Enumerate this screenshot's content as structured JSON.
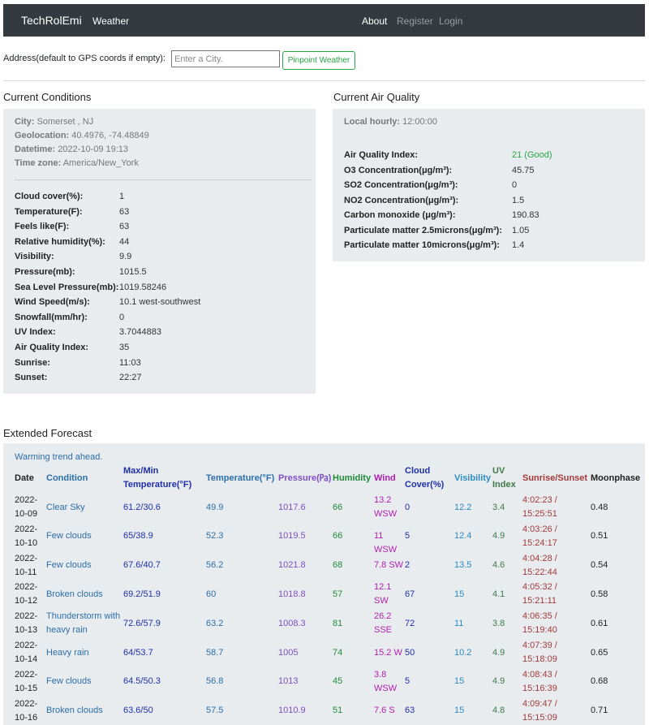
{
  "nav": {
    "brand": "TechRolEmi",
    "weather": "Weather",
    "about": "About",
    "register": "Register",
    "login": "Login"
  },
  "address": {
    "label": "Address(default to GPS coords if empty):",
    "placeholder": "Enter a City.",
    "value": "",
    "button": "Pinpoint Weather"
  },
  "current": {
    "title": "Current Conditions",
    "city_label": "City:",
    "city": "Somerset , NJ",
    "geo_label": "Geolocation:",
    "geo": "40.4976, -74.48849",
    "datetime_label": "Datetime:",
    "datetime": "2022-10-09 19:13",
    "tz_label": "Time zone:",
    "tz": "America/New_York",
    "rows": [
      {
        "label": "Cloud cover(%):",
        "value": "1"
      },
      {
        "label": "Temperature(F):",
        "value": "63"
      },
      {
        "label": "Feels like(F):",
        "value": "63"
      },
      {
        "label": "Relative humidity(%):",
        "value": "44"
      },
      {
        "label": "Visibility:",
        "value": "9.9"
      },
      {
        "label": "Pressure(mb):",
        "value": "1015.5"
      },
      {
        "label": "Sea Level Pressure(mb):",
        "value": "1019.58246"
      },
      {
        "label": "Wind Speed(m/s):",
        "value": "10.1 west-southwest"
      },
      {
        "label": "Snowfall(mm/hr):",
        "value": "0"
      },
      {
        "label": "UV Index:",
        "value": "3.7044883"
      },
      {
        "label": "Air Quality Index:",
        "value": "35"
      },
      {
        "label": "Sunrise:",
        "value": "11:03"
      },
      {
        "label": "Sunset:",
        "value": "22:27"
      }
    ]
  },
  "air": {
    "title": "Current Air Quality",
    "local_label": "Local hourly:",
    "local": "12:00:00",
    "rows": [
      {
        "label": "Air Quality Index:",
        "value": "21 (Good)"
      },
      {
        "label": "O3 Concentration(μg/m³):",
        "value": "45.75"
      },
      {
        "label": "SO2 Concentration(μg/m³):",
        "value": "0"
      },
      {
        "label": "NO2 Concentration(μg/m³):",
        "value": "1.5"
      },
      {
        "label": "Carbon monoxide (μg/m³):",
        "value": "190.83"
      },
      {
        "label": "Particulate matter 2.5microns(μg/m³):",
        "value": "1.05"
      },
      {
        "label": "Particulate matter 10microns(μg/m³):",
        "value": "1.4"
      }
    ]
  },
  "forecast": {
    "title": "Extended Forecast",
    "trend": "Warming trend ahead.",
    "headers": {
      "date": "Date",
      "condition": "Condition",
      "maxmin": "Max/Min Temperature(°F)",
      "temp": "Temperature(°F)",
      "pressure": "Pressure(㎩)",
      "humidity": "Humidity",
      "wind": "Wind",
      "cloud": "Cloud Cover(%)",
      "visibility": "Visibility",
      "uv": "UV Index",
      "sun": "Sunrise/Sunset",
      "moon": "Moonphase"
    },
    "rows": [
      {
        "date": "2022-10-09",
        "condition": "Clear Sky",
        "maxmin": "61.2/30.6",
        "temp": "49.9",
        "pressure": "1017.6",
        "humidity": "66",
        "wind": "13.2 WSW",
        "cloud": "0",
        "visibility": "12.2",
        "uv": "3.4",
        "sun": "4:02:23 / 15:25:51",
        "moon": "0.48"
      },
      {
        "date": "2022-10-10",
        "condition": "Few clouds",
        "maxmin": "65/38.9",
        "temp": "52.3",
        "pressure": "1019.5",
        "humidity": "66",
        "wind": "11 WSW",
        "cloud": "5",
        "visibility": "12.4",
        "uv": "4.9",
        "sun": "4:03:26 / 15:24:17",
        "moon": "0.51"
      },
      {
        "date": "2022-10-11",
        "condition": "Few clouds",
        "maxmin": "67.6/40.7",
        "temp": "56.2",
        "pressure": "1021.8",
        "humidity": "68",
        "wind": "7.8 SW",
        "cloud": "2",
        "visibility": "13.5",
        "uv": "4.6",
        "sun": "4:04:28 / 15:22:44",
        "moon": "0.54"
      },
      {
        "date": "2022-10-12",
        "condition": "Broken clouds",
        "maxmin": "69.2/51.9",
        "temp": "60",
        "pressure": "1018.8",
        "humidity": "57",
        "wind": "12.1 SW",
        "cloud": "67",
        "visibility": "15",
        "uv": "4.1",
        "sun": "4:05:32 / 15:21:11",
        "moon": "0.58"
      },
      {
        "date": "2022-10-13",
        "condition": "Thunderstorm with heavy rain",
        "maxmin": "72.6/57.9",
        "temp": "63.2",
        "pressure": "1008.3",
        "humidity": "81",
        "wind": "26.2 SSE",
        "cloud": "72",
        "visibility": "11",
        "uv": "3.8",
        "sun": "4:06:35 / 15:19:40",
        "moon": "0.61"
      },
      {
        "date": "2022-10-14",
        "condition": "Heavy rain",
        "maxmin": "64/53.7",
        "temp": "58.7",
        "pressure": "1005",
        "humidity": "74",
        "wind": "15.2 W",
        "cloud": "50",
        "visibility": "10.2",
        "uv": "4.9",
        "sun": "4:07:39 / 15:18:09",
        "moon": "0.65"
      },
      {
        "date": "2022-10-15",
        "condition": "Few clouds",
        "maxmin": "64.5/50.3",
        "temp": "56.8",
        "pressure": "1013",
        "humidity": "45",
        "wind": "3.8 WSW",
        "cloud": "5",
        "visibility": "15",
        "uv": "4.9",
        "sun": "4:08:43 / 15:16:39",
        "moon": "0.68"
      },
      {
        "date": "2022-10-16",
        "condition": "Broken clouds",
        "maxmin": "63.6/50",
        "temp": "57.5",
        "pressure": "1010.9",
        "humidity": "51",
        "wind": "7.6 S",
        "cloud": "63",
        "visibility": "15",
        "uv": "4.8",
        "sun": "4:09:47 / 15:15:09",
        "moon": "0.71"
      }
    ]
  }
}
